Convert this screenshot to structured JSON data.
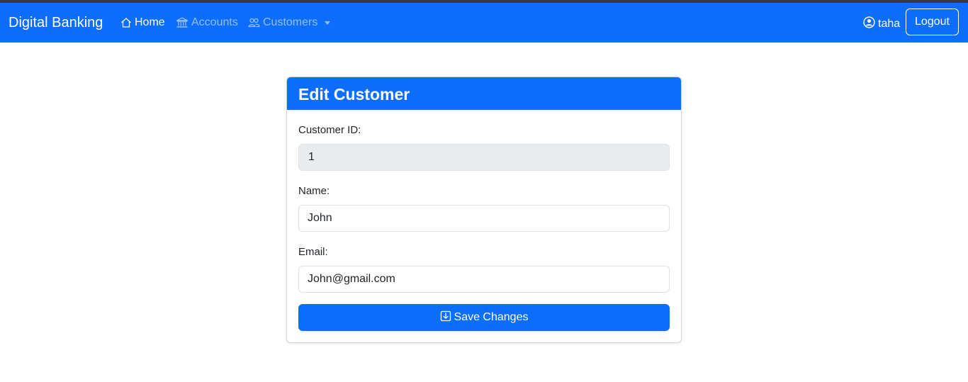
{
  "navbar": {
    "brand": "Digital Banking",
    "links": [
      {
        "label": "Home",
        "icon": "house-icon",
        "active": true
      },
      {
        "label": "Accounts",
        "icon": "bank-icon",
        "active": false
      },
      {
        "label": "Customers",
        "icon": "people-icon",
        "active": false,
        "dropdown": true
      }
    ],
    "user": {
      "name": "taha",
      "icon": "person-circle-icon"
    },
    "logout_label": "Logout"
  },
  "card": {
    "title": "Edit Customer",
    "fields": {
      "id": {
        "label": "Customer ID:",
        "value": "1",
        "readonly": true
      },
      "name": {
        "label": "Name:",
        "value": "John"
      },
      "email": {
        "label": "Email:",
        "value": "John@gmail.com"
      }
    },
    "save_label": "Save Changes",
    "save_icon": "download-box-icon"
  },
  "colors": {
    "primary": "#0d6efd",
    "navbar_topline": "#343a40",
    "readonly_bg": "#e9ecef",
    "input_border": "#dee2e6"
  }
}
